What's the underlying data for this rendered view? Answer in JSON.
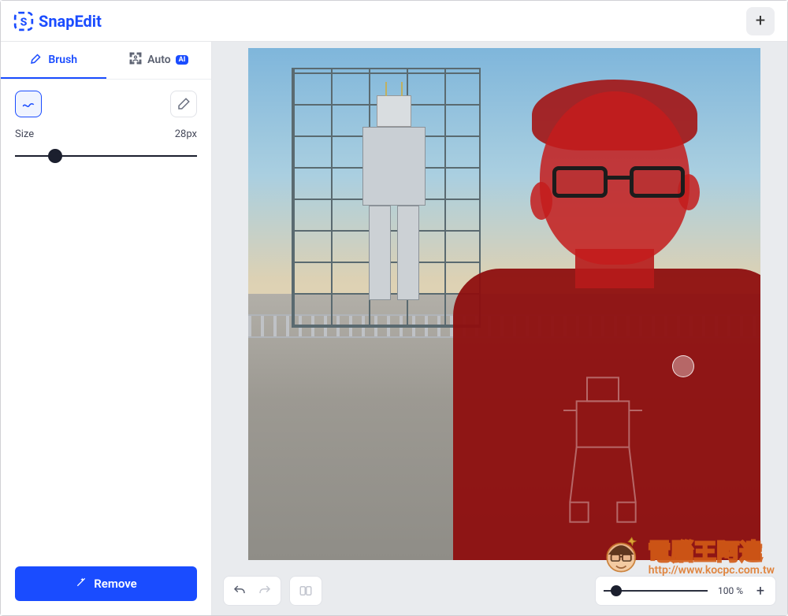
{
  "app": {
    "name": "SnapEdit"
  },
  "tabs": {
    "brush": "Brush",
    "auto": "Auto",
    "ai_badge": "AI"
  },
  "panel": {
    "size_label": "Size",
    "size_value": "28px",
    "brush_size_percent": 22
  },
  "actions": {
    "remove": "Remove"
  },
  "zoom": {
    "label": "100 %",
    "percent": 12,
    "plus": "+"
  },
  "watermark": {
    "title": "電腦王阿達",
    "url": "http://www.kocpc.com.tw"
  },
  "icons": {
    "plus": "+"
  }
}
